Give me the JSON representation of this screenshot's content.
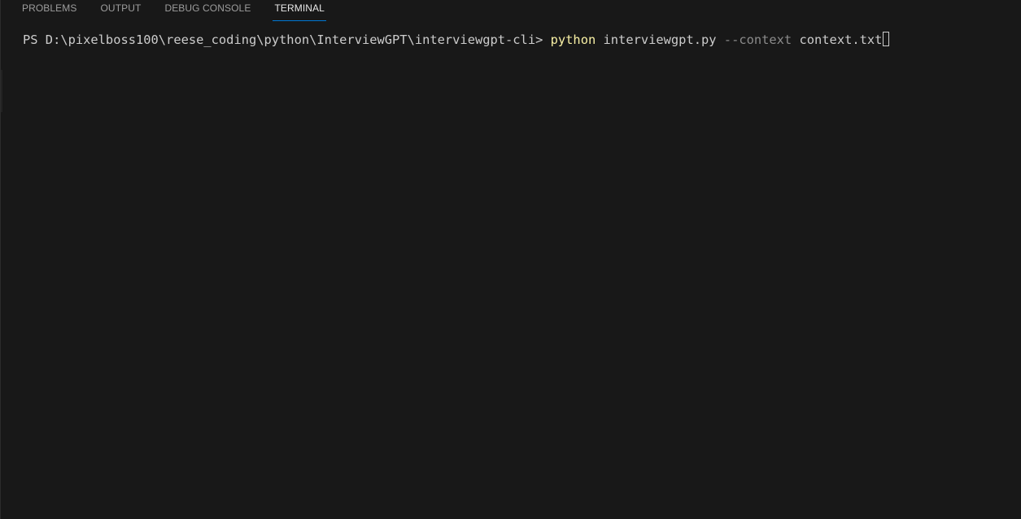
{
  "tabs": [
    {
      "label": "PROBLEMS",
      "active": false
    },
    {
      "label": "OUTPUT",
      "active": false
    },
    {
      "label": "DEBUG CONSOLE",
      "active": false
    },
    {
      "label": "TERMINAL",
      "active": true
    }
  ],
  "terminal": {
    "prompt": "PS D:\\pixelboss100\\reese_coding\\python\\InterviewGPT\\interviewgpt-cli> ",
    "command": "python",
    "script": "interviewgpt.py",
    "param": "--context",
    "arg": "context.txt"
  },
  "colors": {
    "background": "#181818",
    "command": "#f9f1a5",
    "param": "#8b8b8b",
    "text": "#cccccc",
    "accent": "#0078d4"
  }
}
